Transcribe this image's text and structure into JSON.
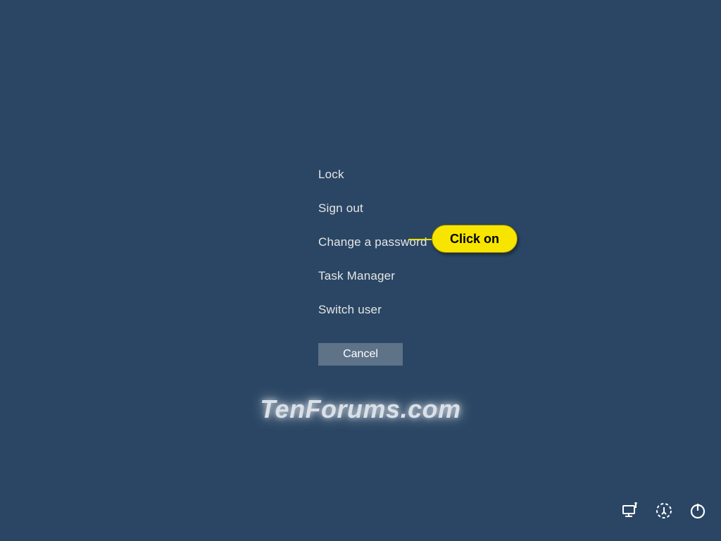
{
  "menu": {
    "items": [
      {
        "label": "Lock"
      },
      {
        "label": "Sign out"
      },
      {
        "label": "Change a password"
      },
      {
        "label": "Task Manager"
      },
      {
        "label": "Switch user"
      }
    ],
    "cancel": "Cancel"
  },
  "callout": {
    "text": "Click on"
  },
  "watermark": "TenForums.com",
  "tray": {
    "network": "network-icon",
    "ease": "ease-of-access-icon",
    "power": "power-icon"
  }
}
